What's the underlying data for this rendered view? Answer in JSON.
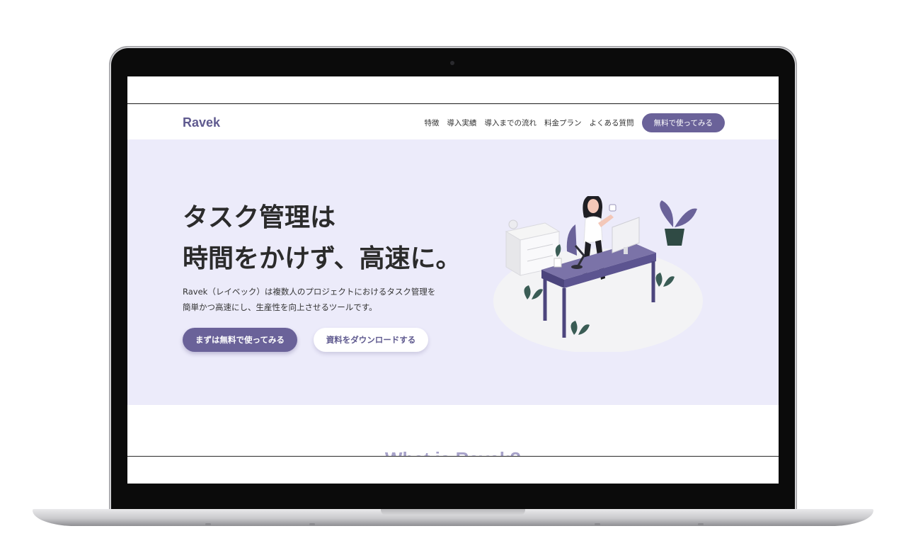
{
  "header": {
    "logo": "Ravek",
    "nav": [
      "特徴",
      "導入実績",
      "導入までの流れ",
      "料金プラン",
      "よくある質問"
    ],
    "cta": "無料で使ってみる"
  },
  "hero": {
    "title_line1": "タスク管理は",
    "title_line2": "時間をかけず、高速に。",
    "lead_line1": "Ravek（レイベック）は複数人のプロジェクトにおけるタスク管理を",
    "lead_line2": "簡単かつ高速にし、生産性を向上させるツールです。",
    "primary_button": "まずは無料で使ってみる",
    "secondary_button": "資料をダウンロードする"
  },
  "next_section": {
    "title": "What is Ravek?"
  },
  "colors": {
    "accent": "#6a6299",
    "hero_bg": "#ecebfa",
    "heading": "#2b2b2b",
    "section_title": "#a7a2c9"
  },
  "icons": {
    "illustration": "woman-at-desk-illustration"
  }
}
